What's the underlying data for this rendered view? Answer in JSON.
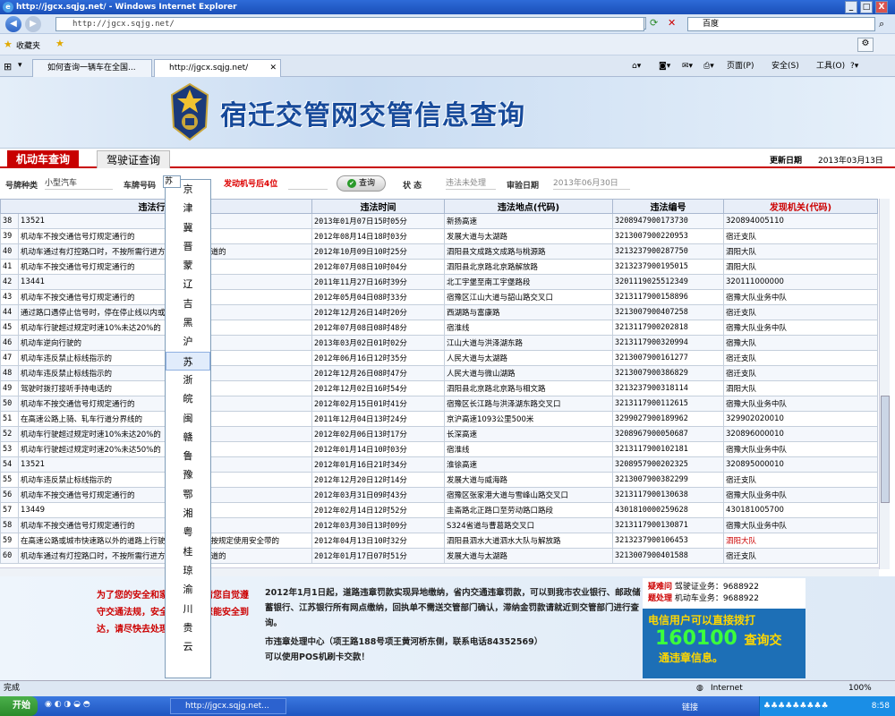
{
  "window": {
    "title": "http://jgcx.sqjg.net/ - Windows Internet Explorer",
    "minimize": "_",
    "maximize": "□",
    "close": "X"
  },
  "address": {
    "url": "http://jgcx.sqjg.net/",
    "search_text": "百度"
  },
  "favorites": {
    "label": "收藏夹"
  },
  "tabs": [
    {
      "label": "如何查询一辆车在全国..."
    },
    {
      "label": "http://jgcx.sqjg.net/"
    }
  ],
  "toolbar": {
    "page": "页面(P)",
    "safety": "安全(S)",
    "tools": "工具(O)"
  },
  "site": {
    "title": "宿迁交管网交管信息查询",
    "tab_vehicle": "机动车查询",
    "tab_license": "驾驶证查询",
    "update_label": "更新日期",
    "update_date": "2013年03月13日"
  },
  "filter": {
    "plate_type_label": "号牌种类",
    "plate_type_value": "小型汽车",
    "plate_no_label": "车牌号码",
    "plate_no_value": "苏",
    "engine_label": "发动机号后4位",
    "query_button": "查询",
    "status_label": "状  态",
    "status_value": "违法未处理",
    "review_label": "审验日期",
    "review_value": "2013年06月30日"
  },
  "dropdown": {
    "selected": "苏",
    "options": [
      "京",
      "津",
      "冀",
      "晋",
      "蒙",
      "辽",
      "吉",
      "黑",
      "沪",
      "苏",
      "浙",
      "皖",
      "闽",
      "赣",
      "鲁",
      "豫",
      "鄂",
      "湘",
      "粤",
      "桂",
      "琼",
      "渝",
      "川",
      "贵",
      "云"
    ]
  },
  "table": {
    "headers": [
      "违法行为",
      "违法时间",
      "违法地点(代码)",
      "违法编号",
      "发现机关(代码)"
    ],
    "rows": [
      {
        "no": "38",
        "act": "13521",
        "time": "2013年01月07日15时05分",
        "place": "新扬高速",
        "code": "320894790017373​0",
        "org": "320894005110",
        "red": false
      },
      {
        "no": "39",
        "act": "机动车不按交通信号灯规定通行的",
        "time": "2012年08月14日18时03分",
        "place": "发展大道与太湖路",
        "code": "3213007900220953",
        "org": "宿迁支队",
        "red": false
      },
      {
        "no": "40",
        "act": "机动车通过有灯控路口时，不按所需行进方向驶入导向车道的",
        "time": "2012年10月09日10时25分",
        "place": "泗阳县文成路文成路与桃源路",
        "code": "3213237900287750",
        "org": "泗阳大队",
        "red": false
      },
      {
        "no": "41",
        "act": "机动车不按交通信号灯规定通行的",
        "time": "2012年07月08日10时04分",
        "place": "泗阳县北京路北京路解放路",
        "code": "3213237900195015",
        "org": "泗阳大队",
        "red": false
      },
      {
        "no": "42",
        "act": "13441",
        "time": "2011年11月27日16时39分",
        "place": "北工宇堡至南工宇堡路段",
        "code": "3201119025512349",
        "org": "320111000000",
        "red": false
      },
      {
        "no": "43",
        "act": "机动车不按交通信号灯规定通行的",
        "time": "2012年05月04日08时33分",
        "place": "宿豫区江山大道与韶山路交叉口",
        "code": "3213117900158896",
        "org": "宿豫大队业务中队",
        "red": false
      },
      {
        "no": "44",
        "act": "通过路口遇停止信号时，停在停止线以内或路口内的",
        "time": "2012年12月26日14时20分",
        "place": "西湖路与富康路",
        "code": "3213007900407258",
        "org": "宿迁支队",
        "red": false
      },
      {
        "no": "45",
        "act": "机动车行驶超过规定时速10%未达20%的",
        "time": "2012年07月08日08时48分",
        "place": "宿淮线",
        "code": "3213117900202818",
        "org": "宿豫大队业务中队",
        "red": false
      },
      {
        "no": "46",
        "act": "机动车逆向行驶的",
        "time": "2013年03月02日01时02分",
        "place": "江山大道与洪泽湖东路",
        "code": "3213117900320994",
        "org": "宿豫大队",
        "red": false
      },
      {
        "no": "47",
        "act": "机动车违反禁止标线指示的",
        "time": "2012年06月16日12时35分",
        "place": "人民大道与太湖路",
        "code": "3213007900161277",
        "org": "宿迁支队",
        "red": false
      },
      {
        "no": "48",
        "act": "机动车违反禁止标线指示的",
        "time": "2012年12月26日08时47分",
        "place": "人民大道与微山湖路",
        "code": "3213007900386829",
        "org": "宿迁支队",
        "red": false
      },
      {
        "no": "49",
        "act": "驾驶时拨打接听手持电话的",
        "time": "2012年12月02日16时54分",
        "place": "泗阳县北京路北京路与相文路",
        "code": "3213237900318114",
        "org": "泗阳大队",
        "red": false
      },
      {
        "no": "50",
        "act": "机动车不按交通信号灯规定通行的",
        "time": "2012年02月15日01时41分",
        "place": "宿豫区长江路与洪泽湖东路交叉口",
        "code": "3213117900112615",
        "org": "宿豫大队业务中队",
        "red": false
      },
      {
        "no": "51",
        "act": "在高速公路上骑、轧车行道分界线的",
        "time": "2011年12月04日13时24分",
        "place": "京沪高速1093公里500米",
        "code": "3299027900189962",
        "org": "329902020010",
        "red": false
      },
      {
        "no": "52",
        "act": "机动车行驶超过规定时速10%未达20%的",
        "time": "2012年02月06日13时17分",
        "place": "长深高速",
        "code": "3208967900050687",
        "org": "320896000010",
        "red": false
      },
      {
        "no": "53",
        "act": "机动车行驶超过规定时速20%未达50%的",
        "time": "2012年01月14日10时03分",
        "place": "宿淮线",
        "code": "3213117900102181",
        "org": "宿豫大队业务中队",
        "red": false
      },
      {
        "no": "54",
        "act": "13521",
        "time": "2012年01月16日21时34分",
        "place": "淮徐高速",
        "code": "3208957900202325",
        "org": "320895000010",
        "red": false
      },
      {
        "no": "55",
        "act": "机动车违反禁止标线指示的",
        "time": "2012年12月20日12时14分",
        "place": "发展大道与威海路",
        "code": "3213007900382299",
        "org": "宿迁支队",
        "red": false
      },
      {
        "no": "56",
        "act": "机动车不按交通信号灯规定通行的",
        "time": "2012年03月31日09时43分",
        "place": "宿豫区张家港大道与雪峰山路交叉口",
        "code": "3213117900130638",
        "org": "宿豫大队业务中队",
        "red": false
      },
      {
        "no": "57",
        "act": "13449",
        "time": "2012年02月14日12时52分",
        "place": "圭斋路北正路口至劳动路口路段",
        "code": "4301810000259628",
        "org": "430181005700",
        "red": false
      },
      {
        "no": "58",
        "act": "机动车不按交通信号灯规定通行的",
        "time": "2012年03月30日13时09分",
        "place": "S324省道与曹葛路交叉口",
        "code": "3213117900130871",
        "org": "宿豫大队业务中队",
        "red": false
      },
      {
        "no": "59",
        "act": "在高速公路或城市快速路以外的道路上行驶时，驾驶人未按规定使用安全带的",
        "time": "2012年04月13日10时32分",
        "place": "泗阳县泗水大道泗水大队与解放路",
        "code": "3213237900106453",
        "org": "泗阳大队",
        "red": true
      },
      {
        "no": "60",
        "act": "机动车通过有灯控路口时，不按所需行进方向驶入导向车道的",
        "time": "2012年01月17日07时51分",
        "place": "发展大道与太湖路",
        "code": "3213007900401588",
        "org": "宿迁支队",
        "red": false
      }
    ]
  },
  "notice": {
    "slogan": "为了您的安全和家庭幸福，请您自觉遵守交通法规，安全出行！为您能安全到达，请尽快去处理交通违章！",
    "p1": "2012年1月1日起，道路违章罚款实现异地缴纳，省内交通违章罚款，可以到我市农业银行、邮政储蓄银行、江苏银行所有网点缴纳，回执单不需送交管部门确认，滞纳金罚款请就近到交管部门进行查询。",
    "p2": "市违章处理中心（项王路188号项王黄河桥东侧，联系电话84352569）",
    "p3": "可以使用POS机刷卡交款！",
    "hotline1_label": "疑难问",
    "hotline1": "驾驶证业务：9688922",
    "hotline2_label": "题处理",
    "hotline2": "机动车业务：9688922",
    "promo1": "电信用户可以直接拨打",
    "promo_number": "160100",
    "promo_tail": "查询交",
    "promo2": "通违章信息。"
  },
  "status": {
    "left": "完成",
    "zone": "Internet",
    "zoom": "100%"
  },
  "taskbar": {
    "start": "开始",
    "item": "http://jgcx.sqjg.net...",
    "links": "链接",
    "clock": "8:58"
  }
}
